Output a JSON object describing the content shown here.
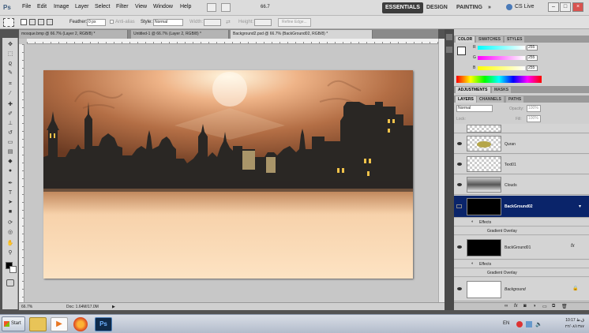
{
  "app": {
    "logo": "Ps",
    "menu": [
      "File",
      "Edit",
      "Image",
      "Layer",
      "Select",
      "Filter",
      "View",
      "Window",
      "Help"
    ],
    "zoom_box": "66.7",
    "workspaces": [
      "ESSENTIALS",
      "DESIGN",
      "PAINTING",
      "»"
    ],
    "cs_live": "CS Live"
  },
  "options": {
    "feather_label": "Feather:",
    "feather_value": "0 px",
    "antialias_label": "Anti-alias",
    "style_label": "Style:",
    "style_value": "Normal",
    "width_label": "Width:",
    "height_label": "Height:",
    "refine_edge": "Refine Edge..."
  },
  "tabs": [
    "mosque.bmp @ 66.7% (Layer 2, RGB/8) *",
    "Untitled-1 @ 66.7% (Layer 2, RGB/8) *",
    "Background2.psd @ 66.7% (BackGround02, RGB/8) *"
  ],
  "status": {
    "zoom": "66.7%",
    "doc": "Doc: 1.64M/17.0M"
  },
  "color_panel": {
    "tabs": [
      "COLOR",
      "SWATCHES",
      "STYLES"
    ],
    "channels": [
      {
        "label": "R",
        "value": "255"
      },
      {
        "label": "G",
        "value": "255"
      },
      {
        "label": "B",
        "value": "255"
      }
    ]
  },
  "adjust_panel": {
    "tabs": [
      "ADJUSTMENTS",
      "MASKS"
    ]
  },
  "layers_panel": {
    "tabs": [
      "LAYERS",
      "CHANNELS",
      "PATHS"
    ],
    "blend_mode": "Normal",
    "opacity_label": "Opacity:",
    "opacity_value": "100%",
    "lock_label": "Lock:",
    "fill_label": "Fill:",
    "fill_value": "100%",
    "layers": [
      {
        "name": ""
      },
      {
        "name": "Quran"
      },
      {
        "name": "Text01"
      },
      {
        "name": "Clouds"
      },
      {
        "name": "BackGround02"
      },
      {
        "name": "Effects"
      },
      {
        "name": "Gradient Overlay"
      },
      {
        "name": "BackGround01"
      },
      {
        "name": "Effects"
      },
      {
        "name": "Gradient Overlay"
      },
      {
        "name": "Background"
      }
    ]
  },
  "taskbar": {
    "start": "Start",
    "lang": "EN",
    "time": "10:17 ق.ظ",
    "date": "۲۲/۰۸/۱۳۸۷"
  },
  "colors": {
    "ui_bg": "#535353",
    "selected_layer": "#0a246a",
    "canvas_sky": "#d9a47a",
    "silhouette": "#2a2724",
    "canvas_bottom": "#fde2c2"
  }
}
